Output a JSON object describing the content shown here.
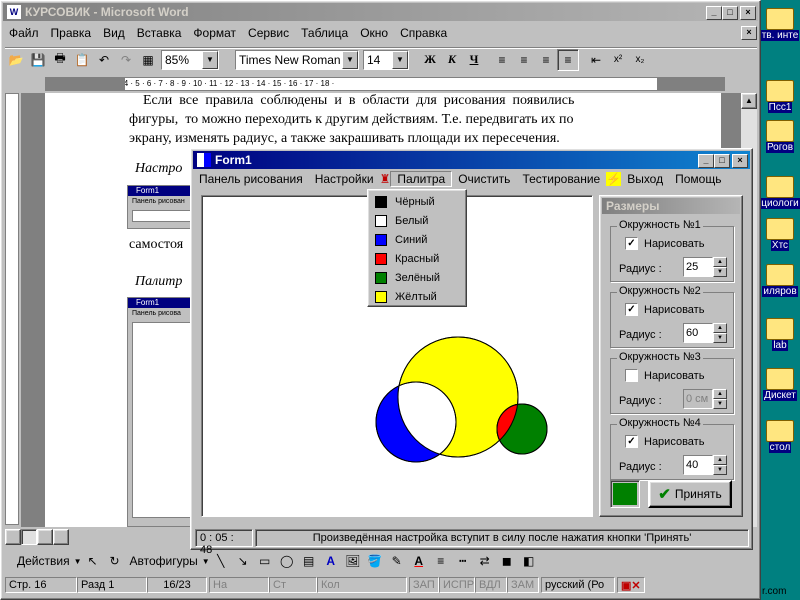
{
  "word": {
    "title": "КУРСОВИК - Microsoft Word",
    "menu": [
      "Файл",
      "Правка",
      "Вид",
      "Вставка",
      "Формат",
      "Сервис",
      "Таблица",
      "Окно",
      "Справка"
    ],
    "zoom": "85%",
    "font": "Times New Roman",
    "font_size": "14",
    "bold": "Ж",
    "italic": "К",
    "underline": "Ч",
    "doc_line1": "Если  все  правила  соблюдены  и  в  области  для  рисования  появились",
    "doc_line2": "фигуры,  то можно переходить к другим действиям. Т.е. передвигать их по",
    "doc_line3": "экрану, изменять радиус, а также закрашивать площади их пересечения.",
    "doc_heading1": "Настро",
    "doc_text2": "самостоя",
    "doc_heading2": "Палитр",
    "thumb1_title": "Form1",
    "thumb1_menu": "Панель рисован",
    "thumb2_title": "Form1",
    "thumb2_menu": "Панель рисова",
    "draw_toolbar": {
      "actions": "Действия",
      "autoshapes": "Автофигуры"
    },
    "status": {
      "page": "Стр.  16",
      "section": "Разд  1",
      "pages": "16/23",
      "at": "На",
      "line": "Ст",
      "col": "Кол",
      "rec": "ЗАП",
      "track": "ИСПР",
      "ext": "ВДЛ",
      "ovr": "ЗАМ",
      "lang": "русский (Ро"
    }
  },
  "form": {
    "title": "Form1",
    "menu": [
      "Панель рисования",
      "Настройки",
      "Палитра",
      "Очистить",
      "Тестирование",
      "Выход",
      "Помощь"
    ],
    "palette": [
      {
        "label": "Чёрный",
        "color": "#000000"
      },
      {
        "label": "Белый",
        "color": "#ffffff"
      },
      {
        "label": "Синий",
        "color": "#0000ff"
      },
      {
        "label": "Красный",
        "color": "#ff0000"
      },
      {
        "label": "Зелёный",
        "color": "#008000"
      },
      {
        "label": "Жёлтый",
        "color": "#ffff00"
      }
    ],
    "panel_title": "Размеры",
    "circles": [
      {
        "legend": "Окружность №1",
        "draw_label": "Нарисовать",
        "checked": true,
        "radius_label": "Радиус :",
        "radius": "25",
        "disabled": false
      },
      {
        "legend": "Окружность №2",
        "draw_label": "Нарисовать",
        "checked": true,
        "radius_label": "Радиус :",
        "radius": "60",
        "disabled": false
      },
      {
        "legend": "Окружность №3",
        "draw_label": "Нарисовать",
        "checked": false,
        "radius_label": "Радиус :",
        "radius": "0 см",
        "disabled": true
      },
      {
        "legend": "Окружность №4",
        "draw_label": "Нарисовать",
        "checked": true,
        "radius_label": "Радиус :",
        "radius": "40",
        "disabled": false
      }
    ],
    "selected_color": "#008000",
    "apply_label": "Принять",
    "timer": "0 : 05 : 48",
    "status_msg": "Произведённая настройка вступит в силу после нажатия кнопки 'Принять'"
  },
  "desktop": {
    "labels": [
      "тв. инте",
      "Псс1",
      "Рогов",
      "циологи",
      "Хтс",
      "иляров",
      "lab",
      "Дискет",
      "стол"
    ],
    "bottom": "r.com"
  }
}
